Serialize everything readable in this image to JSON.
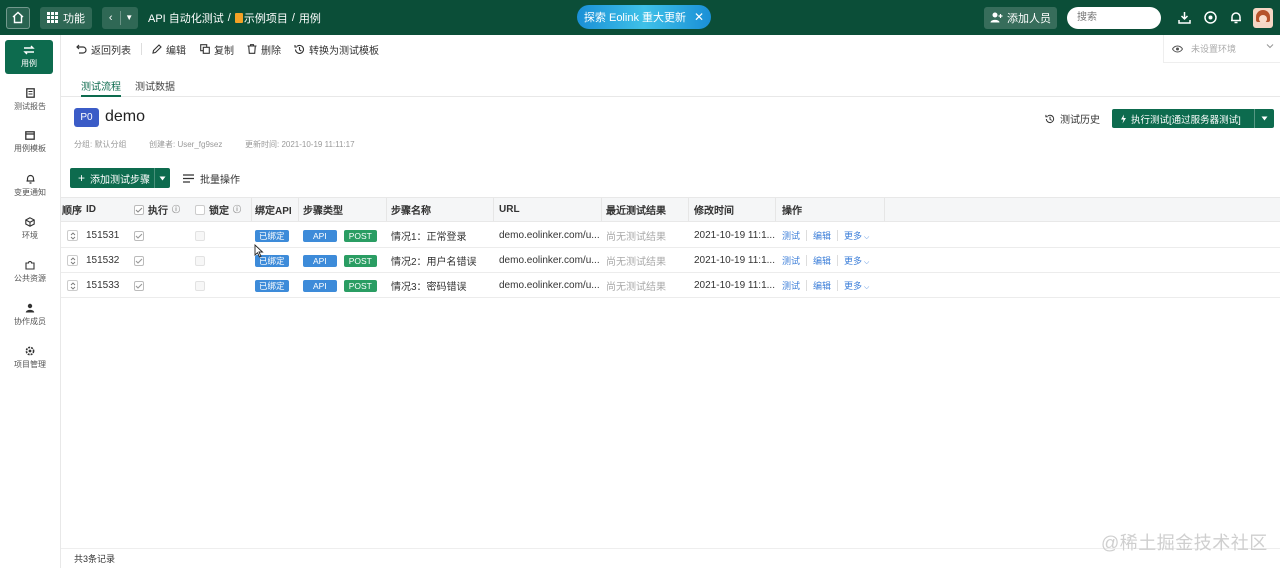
{
  "topbar": {
    "func_label": "功能",
    "breadcrumb": [
      "API 自动化测试",
      "/",
      "示例项目",
      "/",
      "用例"
    ],
    "banner": "探索 Eolink 重大更新",
    "add_member": "添加人员",
    "search_placeholder": "搜索"
  },
  "sidebar": {
    "items": [
      {
        "label": "用例",
        "icon": "swap-icon",
        "active": true
      },
      {
        "label": "测试报告",
        "icon": "report-icon"
      },
      {
        "label": "用例模板",
        "icon": "template-icon"
      },
      {
        "label": "变更通知",
        "icon": "bell-icon"
      },
      {
        "label": "环境",
        "icon": "cube-icon"
      },
      {
        "label": "公共资源",
        "icon": "puzzle-icon"
      },
      {
        "label": "协作成员",
        "icon": "members-icon"
      },
      {
        "label": "项目管理",
        "icon": "gear-icon"
      }
    ]
  },
  "toolbar": {
    "back": "返回列表",
    "edit": "编辑",
    "copy": "复制",
    "delete": "删除",
    "convert": "转换为测试模板",
    "env_placeholder": "未设置环境"
  },
  "tabs": [
    "测试流程",
    "测试数据"
  ],
  "case": {
    "priority": "P0",
    "name": "demo",
    "group": "分组: 默认分组",
    "creator": "创建者: User_fg9sez",
    "updated": "更新时间: 2021-10-19 11:11:17",
    "history": "测试历史",
    "run_label": "执行测试[通过服务器测试]"
  },
  "actions": {
    "add_step": "添加测试步骤",
    "batch": "批量操作"
  },
  "table": {
    "headers": {
      "order": "顺序",
      "id": "ID",
      "exec": "执行",
      "lock": "锁定",
      "bind_api": "绑定API",
      "step_type": "步骤类型",
      "step_name": "步骤名称",
      "url": "URL",
      "last_result": "最近测试结果",
      "modified": "修改时间",
      "ops": "操作"
    },
    "rows": [
      {
        "id": "151531",
        "bound": "已绑定",
        "type": "API",
        "method": "POST",
        "name": "情况1：正常登录",
        "url": "demo.eolinker.com/u...",
        "result": "尚无测试结果",
        "time": "2021-10-19 11:1...",
        "op_test": "测试",
        "op_edit": "编辑",
        "op_more": "更多"
      },
      {
        "id": "151532",
        "bound": "已绑定",
        "type": "API",
        "method": "POST",
        "name": "情况2：用户名错误",
        "url": "demo.eolinker.com/u...",
        "result": "尚无测试结果",
        "time": "2021-10-19 11:1...",
        "op_test": "测试",
        "op_edit": "编辑",
        "op_more": "更多"
      },
      {
        "id": "151533",
        "bound": "已绑定",
        "type": "API",
        "method": "POST",
        "name": "情况3：密码错误",
        "url": "demo.eolinker.com/u...",
        "result": "尚无测试结果",
        "time": "2021-10-19 11:1...",
        "op_test": "测试",
        "op_edit": "编辑",
        "op_more": "更多"
      }
    ]
  },
  "footer": {
    "total": "共3条记录"
  },
  "watermark": "@稀土掘金技术社区",
  "colors": {
    "brand": "#0b4e38",
    "primary": "#0d6b4e",
    "link": "#3d7fd9",
    "tag_blue": "#3d8bd9",
    "tag_green": "#2a9d63",
    "priority": "#3b5cc7"
  }
}
